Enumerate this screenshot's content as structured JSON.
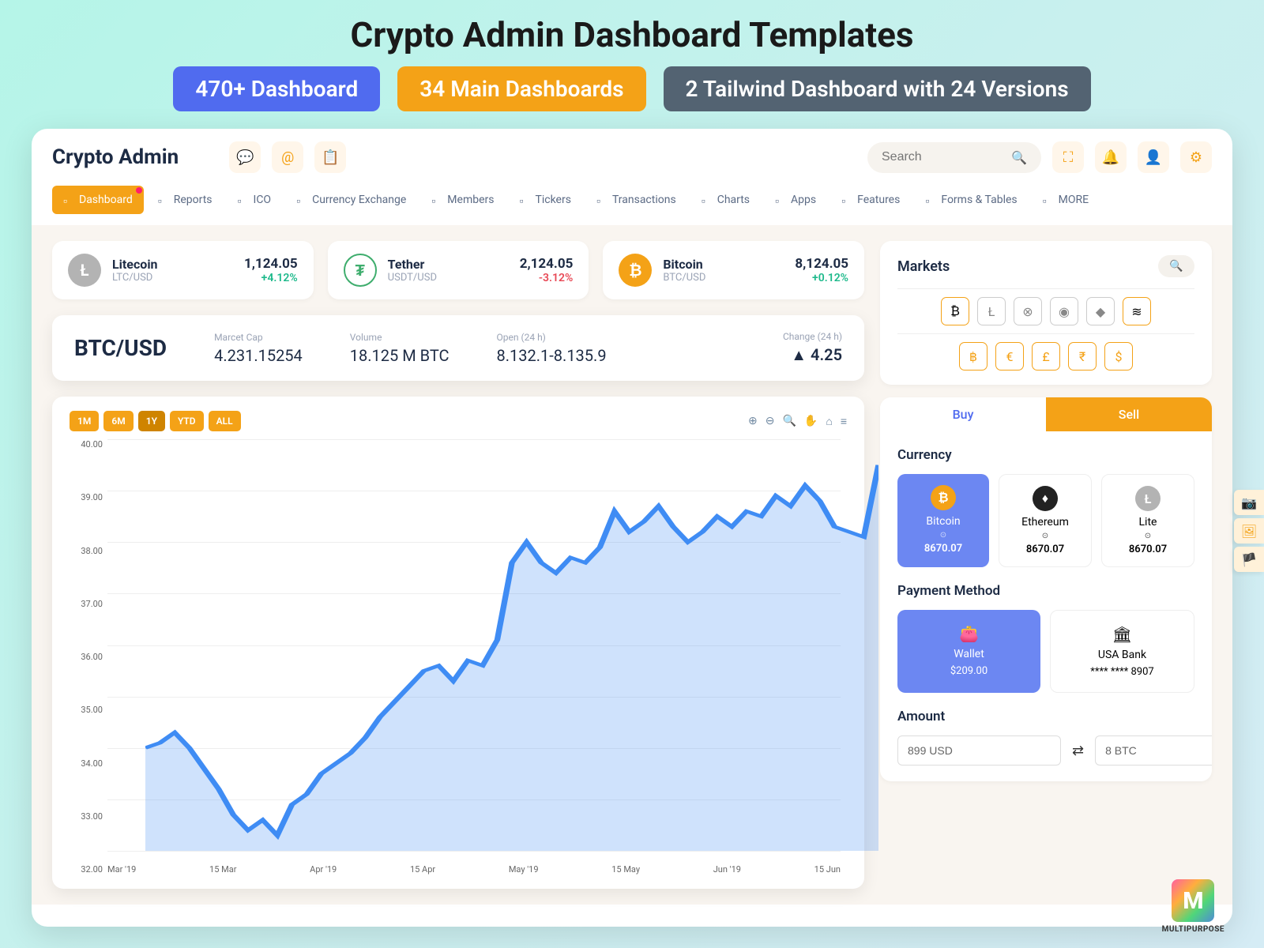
{
  "promo": {
    "title": "Crypto Admin Dashboard Templates",
    "badges": [
      {
        "text": "470+ Dashboard",
        "cls": "badge-blue"
      },
      {
        "text": "34 Main Dashboards",
        "cls": "badge-orange"
      },
      {
        "text": "2 Tailwind Dashboard with 24 Versions",
        "cls": "badge-gray"
      }
    ]
  },
  "brand": "Crypto Admin",
  "search": {
    "placeholder": "Search"
  },
  "nav": [
    {
      "label": "Dashboard",
      "active": true,
      "dot": true
    },
    {
      "label": "Reports"
    },
    {
      "label": "ICO"
    },
    {
      "label": "Currency Exchange"
    },
    {
      "label": "Members"
    },
    {
      "label": "Tickers"
    },
    {
      "label": "Transactions"
    },
    {
      "label": "Charts"
    },
    {
      "label": "Apps"
    },
    {
      "label": "Features"
    },
    {
      "label": "Forms & Tables"
    },
    {
      "label": "MORE"
    }
  ],
  "tickers": [
    {
      "name": "Litecoin",
      "pair": "LTC/USD",
      "price": "1,124.05",
      "change": "+4.12%",
      "dir": "pos",
      "icon": "ci-ltc",
      "glyph": "Ł"
    },
    {
      "name": "Tether",
      "pair": "USDT/USD",
      "price": "2,124.05",
      "change": "-3.12%",
      "dir": "neg",
      "icon": "ci-usdt",
      "glyph": "₮"
    },
    {
      "name": "Bitcoin",
      "pair": "BTC/USD",
      "price": "8,124.05",
      "change": "+0.12%",
      "dir": "pos",
      "icon": "ci-btc",
      "glyph": "₿"
    }
  ],
  "mainPair": {
    "pair": "BTC/USD",
    "marketCap": {
      "label": "Marcet Cap",
      "value": "4.231.15254"
    },
    "volume": {
      "label": "Volume",
      "value": "18.125 M BTC"
    },
    "open": {
      "label": "Open (24 h)",
      "value": "8.132.1-8.135.9"
    },
    "change": {
      "label": "Change (24 h)",
      "value": "▲ 4.25"
    }
  },
  "ranges": [
    "1M",
    "6M",
    "1Y",
    "YTD",
    "ALL"
  ],
  "rangeActive": "1Y",
  "chart_data": {
    "type": "line",
    "title": "",
    "xlabel": "",
    "ylabel": "",
    "ylim": [
      32,
      40
    ],
    "y_ticks": [
      "40.00",
      "39.00",
      "38.00",
      "37.00",
      "36.00",
      "35.00",
      "34.00",
      "33.00",
      "32.00"
    ],
    "x_ticks": [
      "Mar '19",
      "15 Mar",
      "Apr '19",
      "15 Apr",
      "May '19",
      "15 May",
      "Jun '19",
      "15 Jun"
    ],
    "x": [
      0,
      2,
      4,
      6,
      8,
      10,
      12,
      14,
      16,
      18,
      20,
      22,
      24,
      26,
      28,
      30,
      32,
      34,
      36,
      38,
      40,
      42,
      44,
      46,
      48,
      50,
      52,
      54,
      56,
      58,
      60,
      62,
      64,
      66,
      68,
      70,
      72,
      74,
      76,
      78,
      80,
      82,
      84,
      86,
      88,
      90,
      92,
      94,
      96,
      98,
      100
    ],
    "values": [
      34.0,
      34.1,
      34.3,
      34.0,
      33.6,
      33.2,
      32.7,
      32.4,
      32.6,
      32.3,
      32.9,
      33.1,
      33.5,
      33.7,
      33.9,
      34.2,
      34.6,
      34.9,
      35.2,
      35.5,
      35.6,
      35.3,
      35.7,
      35.6,
      36.1,
      37.6,
      38.0,
      37.6,
      37.4,
      37.7,
      37.6,
      37.9,
      38.6,
      38.2,
      38.4,
      38.7,
      38.3,
      38.0,
      38.2,
      38.5,
      38.3,
      38.6,
      38.5,
      38.9,
      38.7,
      39.1,
      38.8,
      38.3,
      38.2,
      38.1,
      39.5
    ]
  },
  "markets": {
    "title": "Markets",
    "row1": [
      "₿",
      "Ł",
      "⊗",
      "◉",
      "◆",
      "≋"
    ],
    "row2": [
      "฿",
      "€",
      "£",
      "₹",
      "$"
    ]
  },
  "buysell": {
    "tabs": {
      "buy": "Buy",
      "sell": "Sell"
    },
    "sections": {
      "currency": "Currency",
      "payment": "Payment Method",
      "amount": "Amount"
    },
    "currencies": [
      {
        "name": "Bitcoin",
        "time": "⊙",
        "price": "8670.07",
        "icon": "curr-btc",
        "glyph": "₿",
        "active": true
      },
      {
        "name": "Ethereum",
        "time": "⊙",
        "price": "8670.07",
        "icon": "curr-eth",
        "glyph": "♦",
        "active": false
      },
      {
        "name": "Lite",
        "time": "⊙",
        "price": "8670.07",
        "icon": "curr-ltc",
        "glyph": "Ł",
        "active": false
      }
    ],
    "payments": [
      {
        "name": "Wallet",
        "value": "$209.00",
        "icon": "👛",
        "active": true
      },
      {
        "name": "USA Bank",
        "value": "**** **** 8907",
        "icon": "🏛",
        "active": false
      }
    ],
    "amountFrom": "899 USD",
    "amountTo": "8 BTC"
  },
  "footerLogo": {
    "letter": "M",
    "text": "MULTIPURPOSE"
  }
}
